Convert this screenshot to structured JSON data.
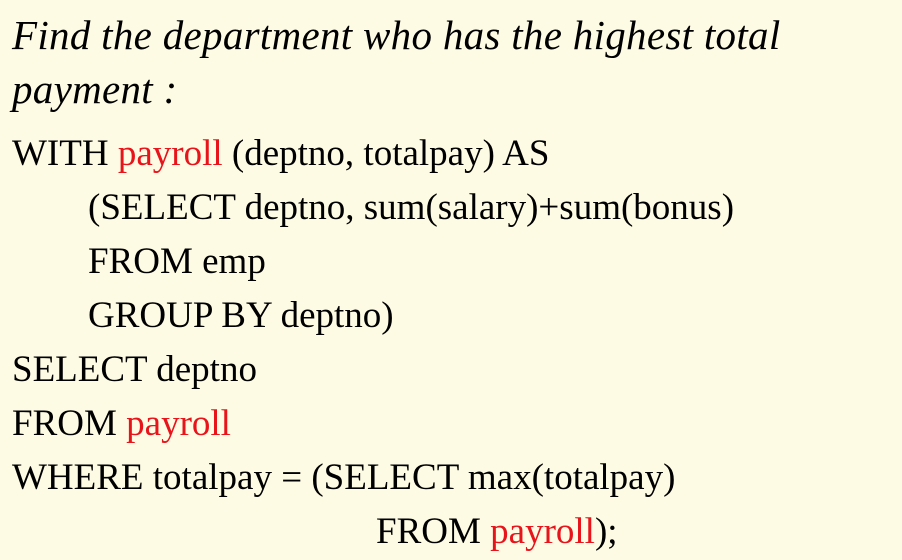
{
  "heading": "Find the department who has the highest total payment :",
  "colors": {
    "background": "#fdfbe3",
    "text": "#000000",
    "highlight": "#e8141b"
  },
  "code": {
    "line1": {
      "a": "WITH ",
      "b": "payroll",
      "c": " (deptno, totalpay) AS"
    },
    "line2": "(SELECT deptno, sum(salary)+sum(bonus)",
    "line3": "FROM emp",
    "line4": "GROUP BY deptno)",
    "line5": "SELECT deptno",
    "line6": {
      "a": "FROM ",
      "b": "payroll"
    },
    "line7": "WHERE totalpay = (SELECT max(totalpay)",
    "line8": {
      "a": "FROM ",
      "b": "payroll",
      "c": ");"
    }
  }
}
